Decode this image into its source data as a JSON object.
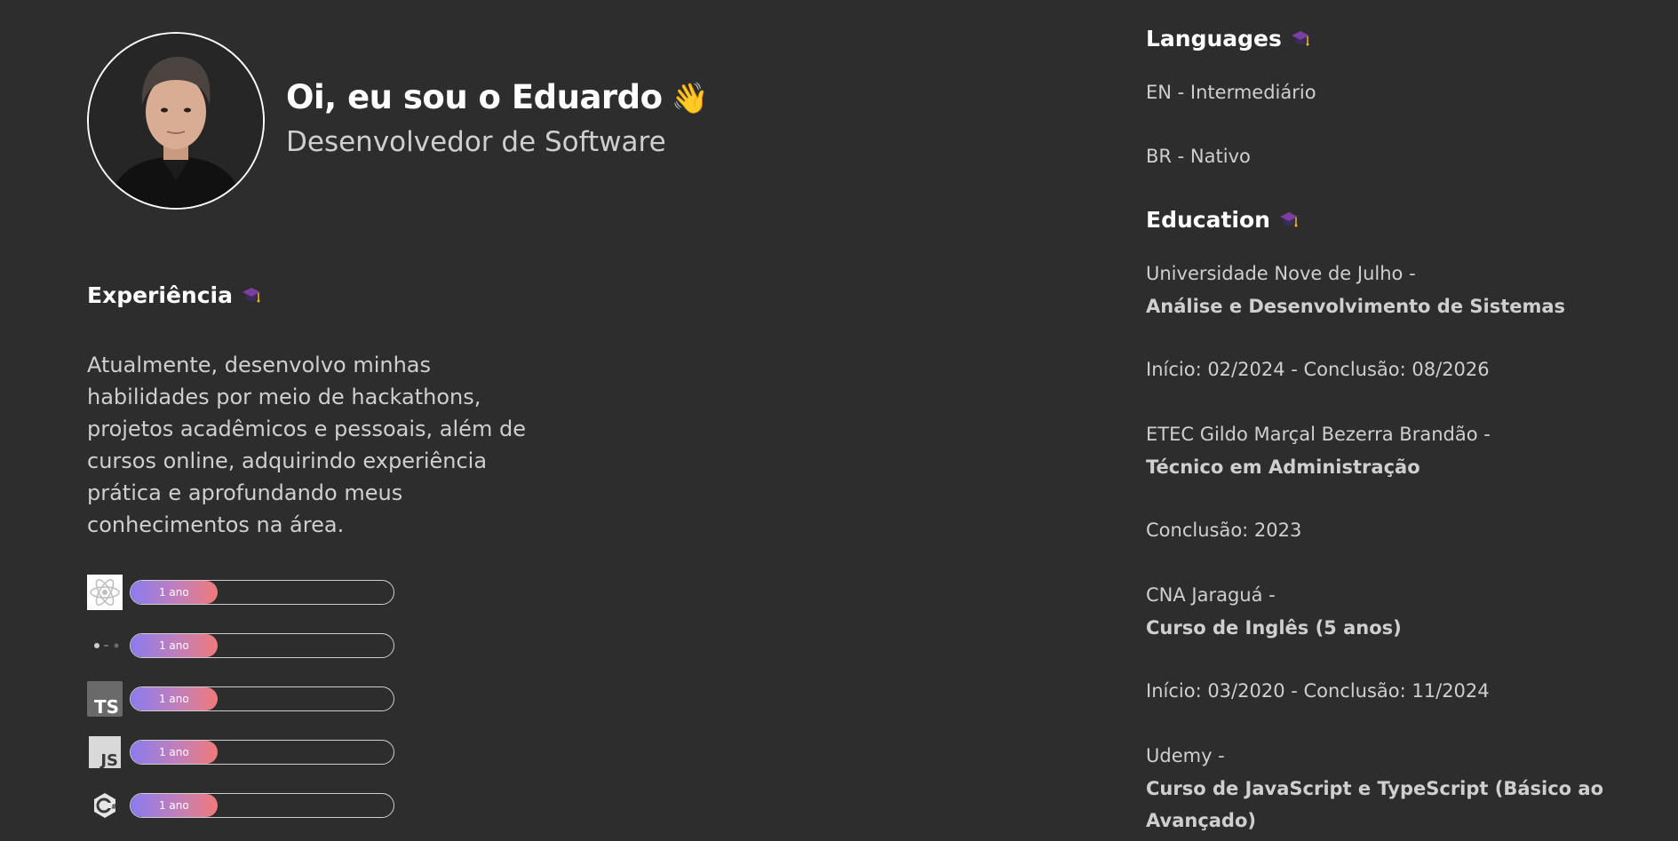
{
  "profile": {
    "greeting": "Oi, eu sou o Eduardo",
    "wave_emoji": "👋",
    "role": "Desenvolvedor de Software"
  },
  "experience": {
    "title": "Experiência",
    "description": "Atualmente, desenvolvo minhas habilidades por meio de hackathons, projetos acadêmicos e pessoais, além de cursos online, adquirindo experiência prática e aprofundando meus conhecimentos na área.",
    "skills": [
      {
        "icon": "react-icon",
        "label": "1 ano",
        "level": 0.33
      },
      {
        "icon": "nextjs-icon",
        "label": "1 ano",
        "level": 0.33
      },
      {
        "icon": "typescript-icon",
        "label": "1 ano",
        "level": 0.33
      },
      {
        "icon": "javascript-icon",
        "label": "1 ano",
        "level": 0.33
      },
      {
        "icon": "csharp-icon",
        "label": "1 ano",
        "level": 0.33
      }
    ]
  },
  "languages": {
    "title": "Languages",
    "items": [
      "EN - Intermediário",
      "BR - Nativo"
    ]
  },
  "education": {
    "title": "Education",
    "entries": [
      {
        "institution": "Universidade Nove de Julho -",
        "course": "Análise e Desenvolvimento de Sistemas",
        "dates": "Início: 02/2024 - Conclusão: 08/2026"
      },
      {
        "institution": "ETEC Gildo Marçal Bezerra Brandão -",
        "course": "Técnico em Administração",
        "dates": "Conclusão: 2023"
      },
      {
        "institution": "CNA Jaraguá -",
        "course": "Curso de Inglês (5 anos)",
        "dates": "Início: 03/2020 - Conclusão: 11/2024"
      },
      {
        "institution": "Udemy -",
        "course": "Curso de JavaScript e TypeScript (Básico ao Avançado)",
        "dates": ""
      }
    ]
  },
  "colors": {
    "background": "#2d2d2d",
    "bar_gradient_start": "#8a7cf0",
    "bar_gradient_end": "#f07a7a",
    "cap_icon": "#8e44ad"
  }
}
